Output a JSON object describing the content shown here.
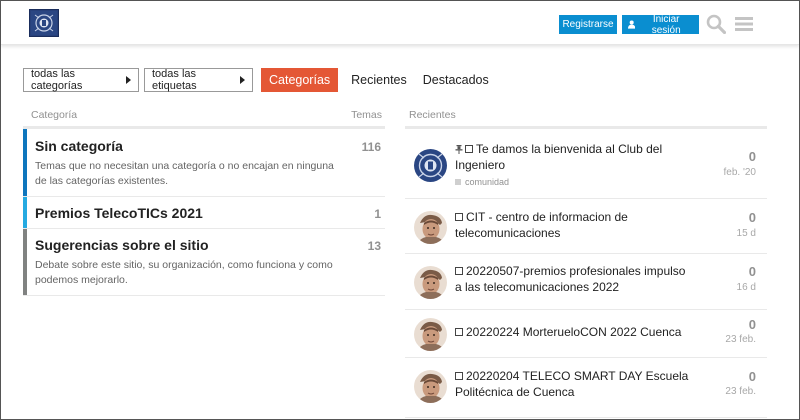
{
  "header": {
    "register_label": "Registrarse",
    "login_label": "Iniciar sesión"
  },
  "nav": {
    "all_categories": "todas las categorías",
    "all_tags": "todas las etiquetas",
    "tabs": [
      "Categorías",
      "Recientes",
      "Destacados"
    ]
  },
  "categories": {
    "header_category": "Categoría",
    "header_topics": "Temas",
    "rows": [
      {
        "title": "Sin categoría",
        "count": "116",
        "desc": "Temas que no necesitan una categoría o no encajan en ninguna de las categorías existentes.",
        "color": "#0e76bd"
      },
      {
        "title": "Premios TelecoTICs 2021",
        "count": "1",
        "desc": "",
        "color": "#25aae1"
      },
      {
        "title": "Sugerencias sobre el sitio",
        "count": "13",
        "desc": "Debate sobre este sitio, su organización, como funciona y como podemos mejorarlo.",
        "color": "#808281"
      }
    ]
  },
  "recent": {
    "header": "Recientes",
    "topics": [
      {
        "title": "Te damos la bienvenida al Club del Ingeniero",
        "pinned": true,
        "tag": "comunidad",
        "count": "0",
        "date": "feb. '20",
        "avatar": "logo"
      },
      {
        "title": "CIT - centro de informacion de telecomunicaciones",
        "pinned": false,
        "tag": "",
        "count": "0",
        "date": "15 d",
        "avatar": "person"
      },
      {
        "title": "20220507-premios profesionales impulso a las telecomunicaciones 2022",
        "pinned": false,
        "tag": "",
        "count": "0",
        "date": "16 d",
        "avatar": "person"
      },
      {
        "title": "20220224 MorterueloCON 2022 Cuenca",
        "pinned": false,
        "tag": "",
        "count": "0",
        "date": "23 feb.",
        "avatar": "person"
      },
      {
        "title": "20220204 TELECO SMART DAY Escuela Politécnica de Cuenca",
        "pinned": false,
        "tag": "",
        "count": "0",
        "date": "23 feb.",
        "avatar": "person"
      }
    ]
  },
  "colors": {
    "accent": "#e45735",
    "primary_button": "#0a8ed0"
  }
}
